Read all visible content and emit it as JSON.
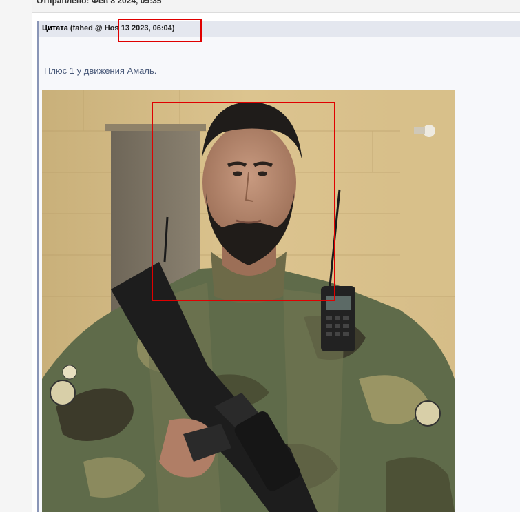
{
  "post": {
    "meta": "Отправлено: Фев 8 2024, 09:35"
  },
  "quote": {
    "label": "Цитата",
    "meta": "(fahed @ Ноя 13 2023, 06:04)",
    "text": "Плюс 1 у движения Амаль."
  },
  "image": {
    "alt": "photo of a bearded man in camouflage uniform holding a rifle, with a radio clipped to his vest"
  },
  "colors": {
    "highlight": "#e00000",
    "quote_border": "#8a96b7",
    "quote_text": "#4a5a7a"
  }
}
